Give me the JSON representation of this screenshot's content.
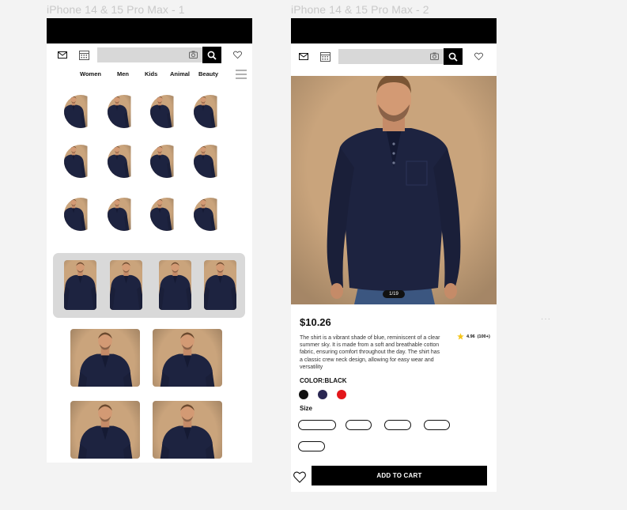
{
  "frames": [
    {
      "label": "iPhone 14 & 15 Pro Max - 1"
    },
    {
      "label": "iPhone 14 & 15 Pro Max - 2"
    }
  ],
  "home": {
    "categories": [
      "Women",
      "Men",
      "Kids",
      "Animal",
      "Beauty"
    ]
  },
  "product": {
    "pager": "1/19",
    "price": "$10.26",
    "description": "The shirt is a vibrant shade of blue, reminiscent of a clear summer sky. It is made from a soft and breathable cotton fabric, ensuring comfort throughout the day. The shirt has a classic crew neck design, allowing for easy wear and versatility",
    "rating_value": "4.96",
    "rating_count": "(100+)",
    "color_label": "COLOR:BLACK",
    "colors": [
      "#111111",
      "#2a2752",
      "#e3171b"
    ],
    "size_label": "Size",
    "add_to_cart": "ADD TO CART"
  },
  "icons": [
    "mail-icon",
    "calendar-icon",
    "camera-icon",
    "search-icon",
    "heart-icon",
    "menu-icon",
    "star-icon"
  ],
  "palette": {
    "shirt": "#1d2340",
    "backdrop": "#c9a47c",
    "accent_star": "#f5c518"
  }
}
